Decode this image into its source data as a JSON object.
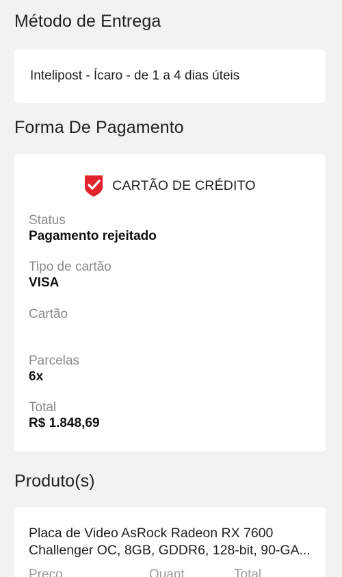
{
  "delivery": {
    "title": "Método de Entrega",
    "method": "Intelipost - Ícaro - de 1 a 4 dias úteis"
  },
  "payment": {
    "title": "Forma De Pagamento",
    "method_label": "CARTÃO DE CRÉDITO",
    "method_icon": "shield-check-icon",
    "accent_color": "#e3232b",
    "fields": [
      {
        "label": "Status",
        "value": "Pagamento rejeitado"
      },
      {
        "label": "Tipo de cartão",
        "value": "VISA"
      },
      {
        "label": "Cartão",
        "value": ""
      },
      {
        "label": "Parcelas",
        "value": "6x"
      },
      {
        "label": "Total",
        "value": "R$ 1.848,69"
      }
    ]
  },
  "products": {
    "title": "Produto(s)",
    "items": [
      {
        "name": "Placa de Video AsRock Radeon RX 7600 Challenger OC, 8GB, GDDR6, 128-bit, 90-GA..."
      }
    ],
    "columns": [
      "Preço",
      "Quant.",
      "Total"
    ]
  }
}
